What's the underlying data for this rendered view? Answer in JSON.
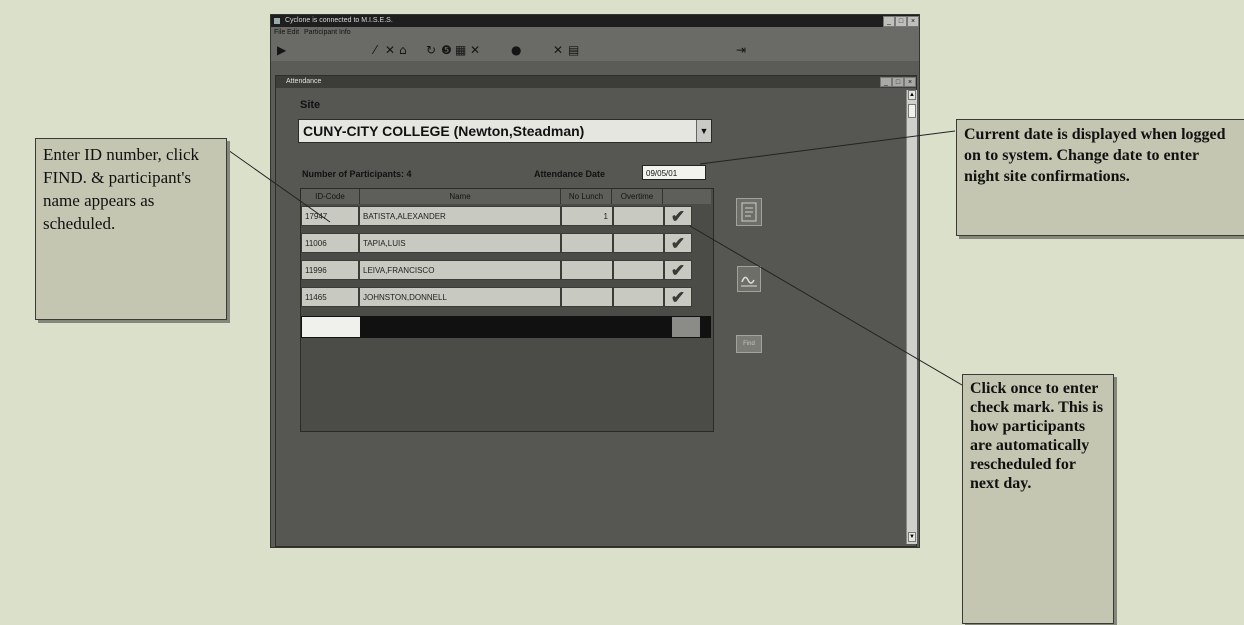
{
  "app_window": {
    "title": "Cyclone is connected to M.I.S.E.S.",
    "menu": [
      "File",
      "Edit",
      "Participant Info"
    ]
  },
  "attendance_window": {
    "title": "Attendance",
    "site_label": "Site",
    "site_value": "CUNY-CITY COLLEGE (Newton,Steadman)",
    "participants_label": "Number of Participants: 4",
    "attendance_date_label": "Attendance Date",
    "attendance_date_value": "09/05/01"
  },
  "grid": {
    "columns": [
      "ID-Code",
      "Name",
      "No Lunch",
      "Overtime"
    ],
    "rows": [
      {
        "id": "17947",
        "name": "BATISTA,ALEXANDER",
        "nolunch": "1",
        "overtime": "",
        "checked": true
      },
      {
        "id": "11006",
        "name": "TAPIA,LUIS",
        "nolunch": "",
        "overtime": "",
        "checked": true
      },
      {
        "id": "11996",
        "name": "LEIVA,FRANCISCO",
        "nolunch": "",
        "overtime": "",
        "checked": true
      },
      {
        "id": "11465",
        "name": "JOHNSTON,DONNELL",
        "nolunch": "",
        "overtime": "",
        "checked": true
      }
    ]
  },
  "side_buttons": {
    "bottom_label": "Find"
  },
  "callouts": {
    "left": "Enter ID number, click FIND. & participant's name appears as scheduled.",
    "date": "Current date is displayed when logged on to system. Change date to enter night site confirmations.",
    "check": "Click once to enter check mark. This is how participants are automatically rescheduled for next day."
  },
  "colors": {
    "background": "#dbe0cb",
    "callout_fill": "#c4c6b2",
    "window_gray": "#5b5b58"
  }
}
